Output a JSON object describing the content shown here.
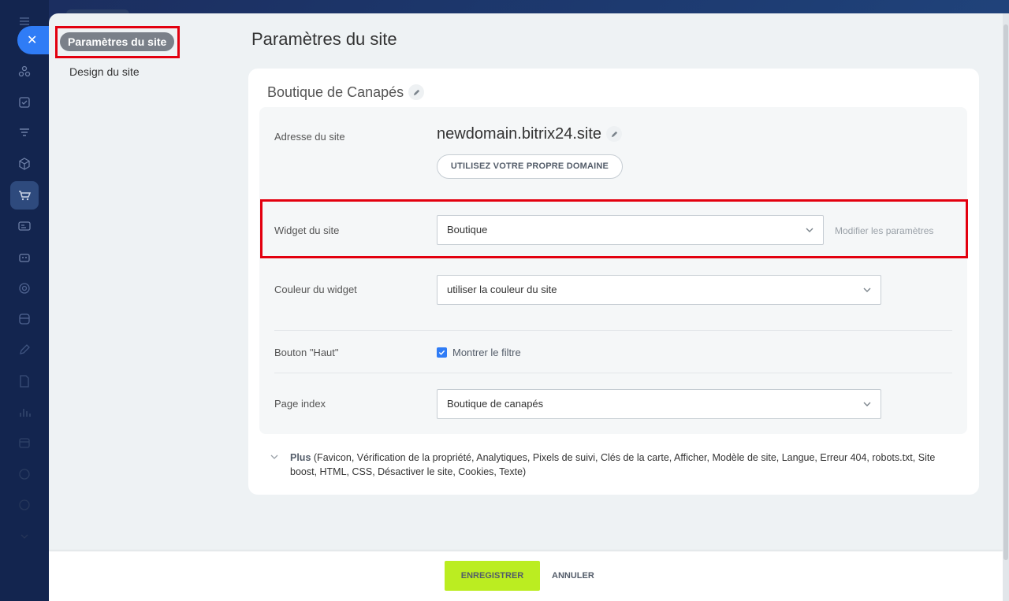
{
  "colors": {
    "accent_blue": "#2f7cf6",
    "save_green": "#bbed21",
    "highlight_red": "#e3000f",
    "rail_bg": "#13254f"
  },
  "rail": {
    "close_icon": "close-icon",
    "icons": [
      "menu-icon",
      "workflow-icon",
      "tasks-icon",
      "filter-icon",
      "box-icon",
      "cart-icon",
      "card-icon",
      "robot-icon",
      "target-icon",
      "database-icon",
      "pen-icon",
      "document-icon",
      "chart-icon",
      "calendar-icon",
      "settings-icon",
      "mail-icon",
      "chevron-down-icon"
    ]
  },
  "sidebar": {
    "items": [
      {
        "label": "Paramètres du site"
      },
      {
        "label": "Design du site"
      }
    ]
  },
  "main": {
    "title": "Paramètres du site",
    "card_title": "Boutique de Canapés",
    "address": {
      "label": "Adresse du site",
      "domain": "newdomain.bitrix24.site",
      "own_domain_button": "UTILISEZ VOTRE PROPRE DOMAINE"
    },
    "widget": {
      "label": "Widget du site",
      "value": "Boutique",
      "modify_link": "Modifier les paramètres"
    },
    "widget_color": {
      "label": "Couleur du widget",
      "value": "utiliser la couleur du site"
    },
    "top_button": {
      "label": "Bouton \"Haut\"",
      "checkbox_label": "Montrer le filtre",
      "checked": true
    },
    "index_page": {
      "label": "Page index",
      "value": "Boutique de canapés"
    },
    "more": {
      "label": "Plus",
      "details": "(Favicon,  Vérification de la propriété,  Analytiques,  Pixels de suivi,  Clés de la carte,  Afficher,  Modèle de site,  Langue,  Erreur 404,  robots.txt,  Site boost,  HTML,  CSS,  Désactiver le site,  Cookies,  Texte)"
    }
  },
  "footer": {
    "save_label": "ENREGISTRER",
    "cancel_label": "ANNULER"
  }
}
